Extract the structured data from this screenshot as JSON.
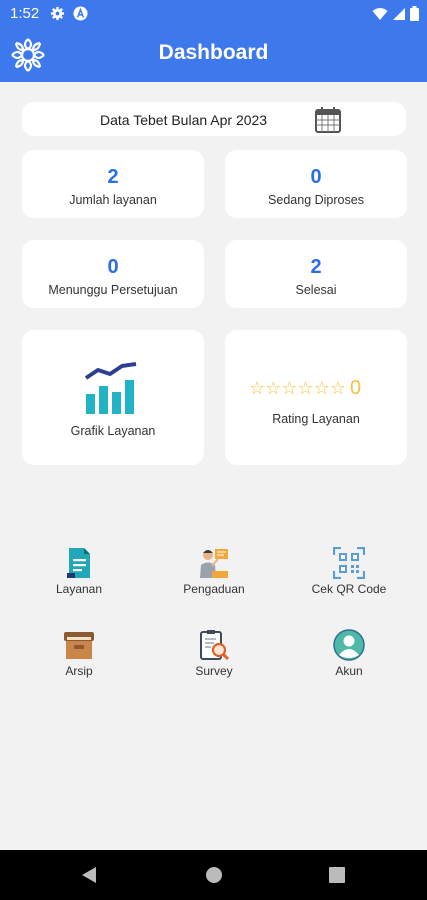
{
  "status_bar": {
    "time": "1:52"
  },
  "app_bar": {
    "title": "Dashboard"
  },
  "period": {
    "text": "Data Tebet Bulan Apr 2023"
  },
  "stats": [
    {
      "value": "2",
      "label": "Jumlah layanan"
    },
    {
      "value": "0",
      "label": "Sedang Diproses"
    },
    {
      "value": "0",
      "label": "Menunggu Persetujuan"
    },
    {
      "value": "2",
      "label": "Selesai"
    }
  ],
  "grafik": {
    "label": "Grafik Layanan",
    "icon": "bar-chart-icon"
  },
  "rating": {
    "stars_filled": 0,
    "stars_total": 6,
    "score": "0",
    "label": "Rating Layanan"
  },
  "menu": [
    {
      "label": "Layanan",
      "icon": "document-icon"
    },
    {
      "label": "Pengaduan",
      "icon": "presenter-icon"
    },
    {
      "label": "Cek QR Code",
      "icon": "qr-code-icon"
    },
    {
      "label": "Arsip",
      "icon": "archive-box-icon"
    },
    {
      "label": "Survey",
      "icon": "survey-search-icon"
    },
    {
      "label": "Akun",
      "icon": "user-avatar-icon"
    }
  ],
  "colors": {
    "primary": "#3d78ec",
    "stat_value": "#2a6fe6",
    "star": "#f5c33b",
    "background": "#f2f2f2"
  }
}
